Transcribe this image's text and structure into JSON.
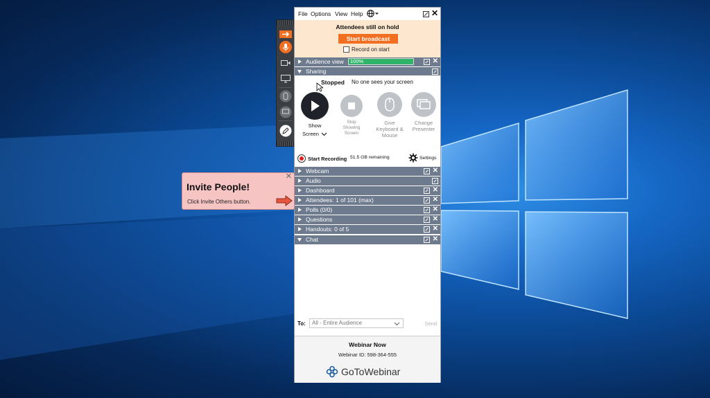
{
  "menubar": {
    "items": [
      "File",
      "Options",
      "View",
      "Help"
    ],
    "globe_icon": "globe-icon"
  },
  "broadcast": {
    "title": "Attendees still on hold",
    "button": "Start broadcast",
    "record_on_start": "Record on start"
  },
  "audience": {
    "label": "Audience view",
    "value": "100%"
  },
  "sharing": {
    "label": "Sharing",
    "status": "Stopped",
    "status_desc": "No one sees your screen",
    "options": [
      {
        "line1": "Show",
        "line2": "Screen"
      },
      {
        "line1": "Stop",
        "line2": "Showing",
        "line3": "Screen"
      },
      {
        "line1": "Give",
        "line2": "Keyboard &",
        "line3": "Mouse"
      },
      {
        "line1": "Change",
        "line2": "Presenter"
      }
    ]
  },
  "recording": {
    "label": "Start Recording",
    "remaining": "51.5 GB remaining",
    "settings": "Settings"
  },
  "panes": [
    "Webcam",
    "Audio",
    "Dashboard",
    "Attendees:  1 of 101 (max)",
    "Polls (0/0)",
    "Questions",
    "Handouts: 0 of 5",
    "Chat"
  ],
  "chat": {
    "to_label": "To:",
    "recipient": "All - Entire Audience",
    "send": "Send"
  },
  "webinar": {
    "title": "Webinar Now",
    "id_label": "Webinar ID: 598-364-555",
    "brand": "GoToWebinar"
  },
  "tooltip": {
    "title": "Invite People!",
    "text": "Click Invite Others button."
  },
  "colors": {
    "accent_orange": "#f26f21",
    "pane_bar": "#6e7b8e",
    "meter_green": "#2fb46a",
    "tooltip_bg": "#f7c4c4"
  }
}
